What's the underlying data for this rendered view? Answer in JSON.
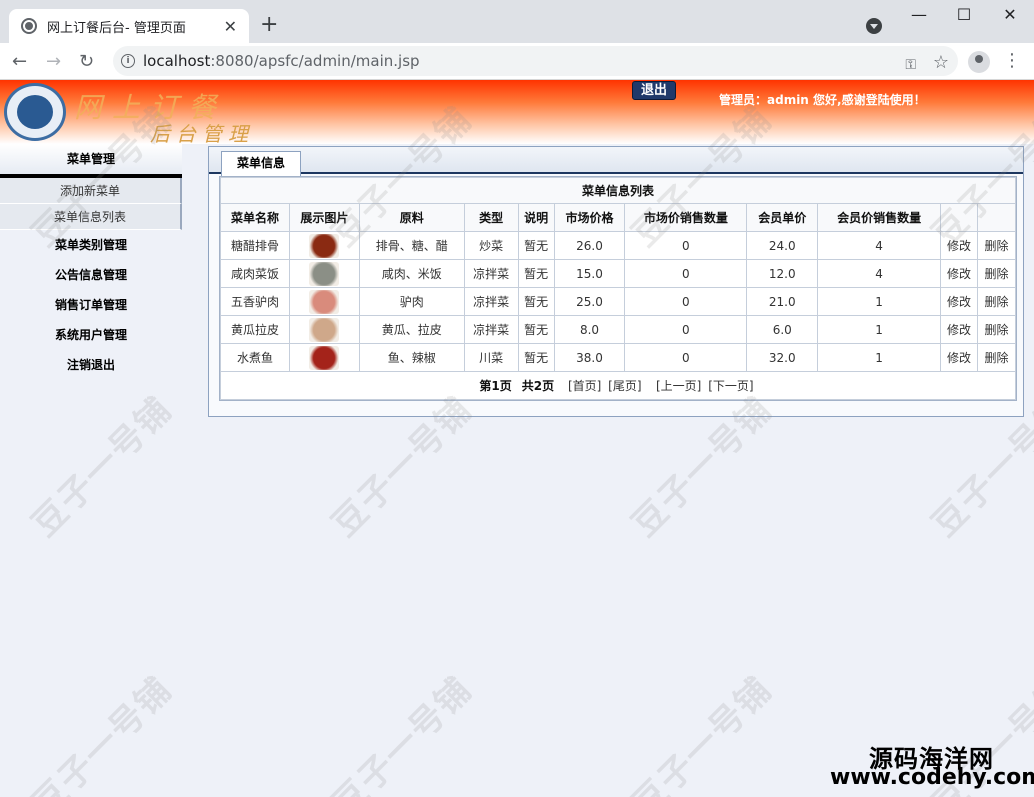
{
  "browser": {
    "tab_title": "网上订餐后台- 管理页面",
    "url_host": "localhost",
    "url_rest": ":8080/apsfc/admin/main.jsp"
  },
  "header": {
    "brand_line1": "网上订餐",
    "brand_line2": "后台管理",
    "logout_label": "退出",
    "greeting": "管理员：admin 您好,感谢登陆使用！"
  },
  "sidebar": {
    "group_title": "菜单管理",
    "sub_items": [
      "添加新菜单",
      "菜单信息列表"
    ],
    "items": [
      "菜单类别管理",
      "公告信息管理",
      "销售订单管理",
      "系统用户管理",
      "注销退出"
    ]
  },
  "panel": {
    "tab_label": "菜单信息",
    "table_title": "菜单信息列表",
    "columns": [
      "菜单名称",
      "展示图片",
      "原料",
      "类型",
      "说明",
      "市场价格",
      "市场价销售数量",
      "会员单价",
      "会员价销售数量",
      "",
      ""
    ],
    "rows": [
      {
        "name": "糖醋排骨",
        "ingredients": "排骨、糖、醋",
        "type": "炒菜",
        "desc": "暂无",
        "market_price": "26.0",
        "market_sold": "0",
        "member_price": "24.0",
        "member_sold": "4",
        "edit": "修改",
        "delete": "删除",
        "img_color": "#8a2a12"
      },
      {
        "name": "咸肉菜饭",
        "ingredients": "咸肉、米饭",
        "type": "凉拌菜",
        "desc": "暂无",
        "market_price": "15.0",
        "market_sold": "0",
        "member_price": "12.0",
        "member_sold": "4",
        "edit": "修改",
        "delete": "删除",
        "img_color": "#8b8f86"
      },
      {
        "name": "五香驴肉",
        "ingredients": "驴肉",
        "type": "凉拌菜",
        "desc": "暂无",
        "market_price": "25.0",
        "market_sold": "0",
        "member_price": "21.0",
        "member_sold": "1",
        "edit": "修改",
        "delete": "删除",
        "img_color": "#d98b7c"
      },
      {
        "name": "黄瓜拉皮",
        "ingredients": "黄瓜、拉皮",
        "type": "凉拌菜",
        "desc": "暂无",
        "market_price": "8.0",
        "market_sold": "0",
        "member_price": "6.0",
        "member_sold": "1",
        "edit": "修改",
        "delete": "删除",
        "img_color": "#cfa88a"
      },
      {
        "name": "水煮鱼",
        "ingredients": "鱼、辣椒",
        "type": "川菜",
        "desc": "暂无",
        "market_price": "38.0",
        "market_sold": "0",
        "member_price": "32.0",
        "member_sold": "1",
        "edit": "修改",
        "delete": "删除",
        "img_color": "#a4231a"
      }
    ],
    "pager": {
      "current": "第1页",
      "total": "共2页",
      "first": "[首页]",
      "last": "[尾页]",
      "prev": "[上一页]",
      "next": "[下一页]"
    }
  },
  "watermark": {
    "text": "豆子一号铺",
    "corner_cn": "源码海洋网",
    "corner_url": "www.codehy.com"
  }
}
